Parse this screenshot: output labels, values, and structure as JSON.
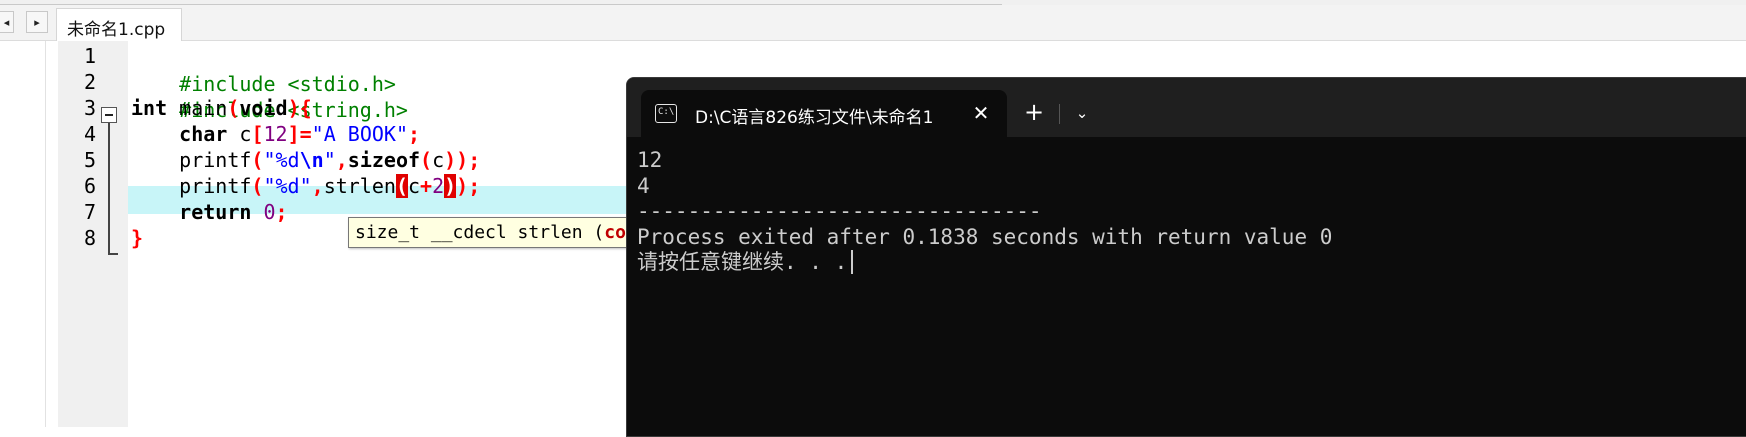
{
  "editor": {
    "nav_prev": "◂",
    "nav_next": "▸",
    "file_tab": "未命名1.cpp",
    "line_numbers": [
      "1",
      "2",
      "3",
      "4",
      "5",
      "6",
      "7",
      "8"
    ],
    "code": {
      "l1_directive": "#include <stdio.h>",
      "l2_directive": "#include <string.h>",
      "l3_type": "int",
      "l3_name": " main",
      "l3_open": "(",
      "l3_param": "void",
      "l3_close": "){",
      "l4_indent": "    ",
      "l4_type": "char",
      "l4_name": " c",
      "l4_lb": "[",
      "l4_num": "12",
      "l4_rb": "]=",
      "l4_str": "\"A BOOK\"",
      "l4_semi": ";",
      "l5_indent": "    ",
      "l5_fn": "printf",
      "l5_open": "(",
      "l5_str_a": "\"%d",
      "l5_esc": "\\n",
      "l5_str_b": "\"",
      "l5_comma": ",",
      "l5_sizeof": "sizeof",
      "l5_open2": "(",
      "l5_arg": "c",
      "l5_close": "));",
      "l6_indent": "    ",
      "l6_fn": "printf",
      "l6_open": "(",
      "l6_str": "\"%d\"",
      "l6_comma": ",",
      "l6_strlen": "strlen",
      "l6_paren_open": "(",
      "l6_arg": "c",
      "l6_plus": "+",
      "l6_num": "2",
      "l6_paren_close": ")",
      "l6_end": ");",
      "l7_indent": "    ",
      "l7_kw": "return",
      "l7_num": " 0",
      "l7_semi": ";",
      "l8_close": "}"
    },
    "tooltip_text": "size_t __cdecl strlen (",
    "tooltip_highlight": "con"
  },
  "terminal": {
    "icon_text": "C:\\",
    "tab_title": "D:\\C语言826练习文件\\未命名1",
    "close_label": "✕",
    "new_tab_label": "+",
    "dropdown_label": "⌄",
    "output": [
      "12",
      "4",
      "--------------------------------",
      "Process exited after 0.1838 seconds with return value 0",
      "请按任意键继续. . ."
    ]
  },
  "colors": {
    "preprocessor": "#008000",
    "string": "#0000ff",
    "symbol": "#ff0000",
    "number": "#800080",
    "highlight_line": "#c8f5f8",
    "terminal_bg": "#0c0c0c",
    "terminal_text": "#cccccc"
  }
}
